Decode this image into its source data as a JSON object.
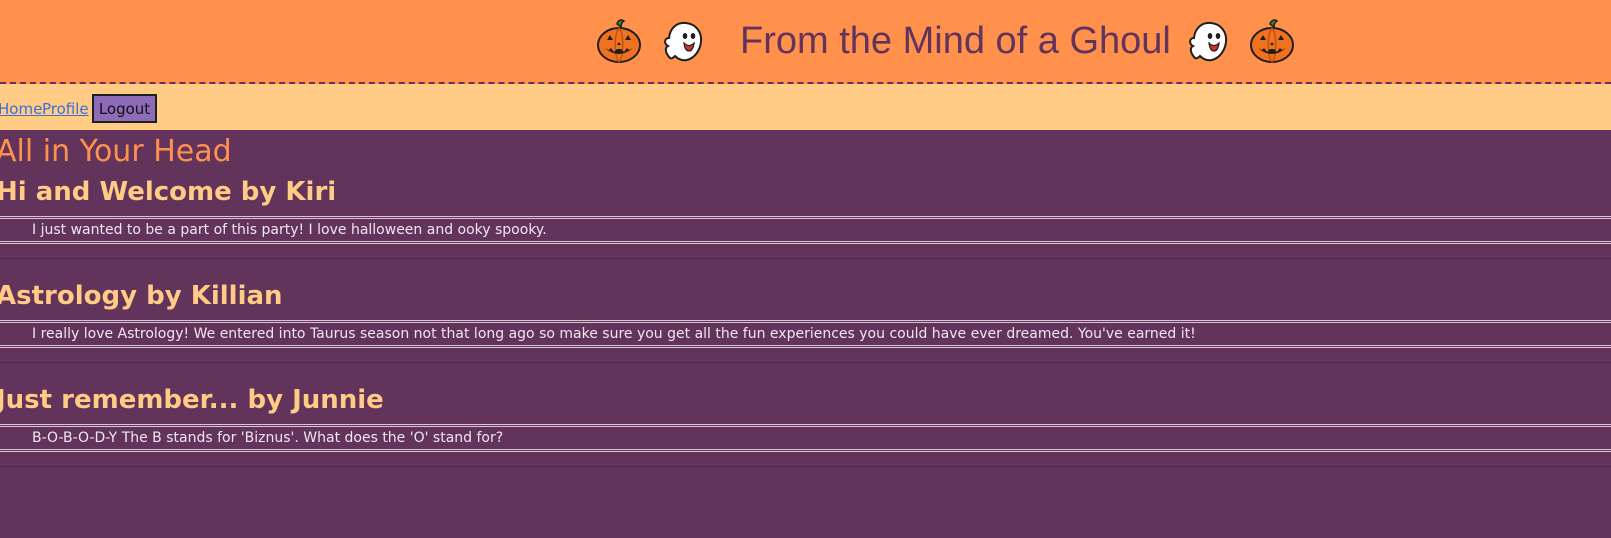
{
  "header": {
    "title": "From the Mind of a Ghoul",
    "icons": [
      "jack-o-lantern-icon",
      "ghost-icon",
      "ghost-icon",
      "jack-o-lantern-icon"
    ]
  },
  "nav": {
    "home_label": "Home",
    "profile_label": "Profile",
    "logout_label": "Logout"
  },
  "main": {
    "page_title": "All in Your Head",
    "posts": [
      {
        "heading": "Hi and Welcome by Kiri",
        "body": "I just wanted to be a part of this party! I love halloween and ooky spooky."
      },
      {
        "heading": "Astrology by Killian",
        "body": "I really love Astrology! We entered into Taurus season not that long ago so make sure you get all the fun experiences you could have ever dreamed. You've earned it!"
      },
      {
        "heading": "Just remember... by Junnie",
        "body": "B-O-B-O-D-Y The B stands for 'Biznus'. What does the 'O' stand for?"
      }
    ]
  },
  "colors": {
    "header_bg": "#ff914d",
    "nav_bg": "#ffcb85",
    "page_bg": "#62345c",
    "title_text": "#62345c",
    "heading_text": "#ffcb85",
    "page_title_text": "#ff914d",
    "logout_bg": "#8e6bb6",
    "link": "#3b6fd9"
  }
}
